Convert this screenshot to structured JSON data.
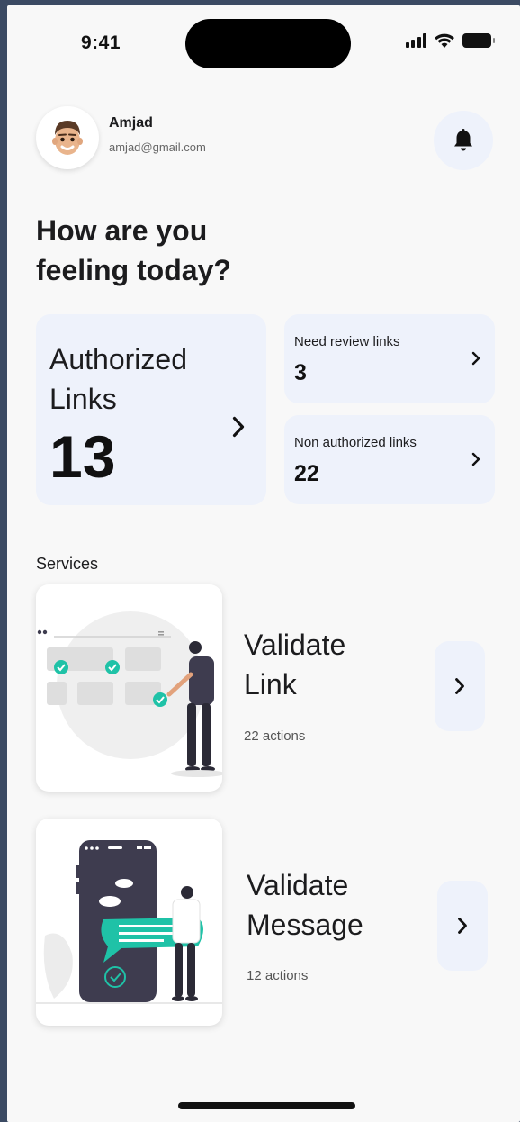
{
  "status_bar": {
    "time": "9:41"
  },
  "user": {
    "name": "Amjad",
    "email": "amjad@gmail.com"
  },
  "greeting": "How are you\nfeeling today?",
  "stats": {
    "authorized": {
      "label": "Authorized\nLinks",
      "count": "13"
    },
    "need_review": {
      "label": "Need review links",
      "count": "3"
    },
    "non_authorized": {
      "label": "Non authorized links",
      "count": "22"
    }
  },
  "services": {
    "title": "Services",
    "items": [
      {
        "name": "Validate\nLink",
        "meta": "22 actions",
        "illustration": "validate-link-illustration"
      },
      {
        "name": "Validate\nMessage",
        "meta": "12 actions",
        "illustration": "validate-message-illustration"
      }
    ]
  },
  "icons": {
    "notification": "bell-icon",
    "chevron": "chevron-right-icon"
  },
  "colors": {
    "background": "#f8f8f8",
    "card": "#eef2fb",
    "accent": "#1fc2a7",
    "dark": "#3e3c4f"
  }
}
